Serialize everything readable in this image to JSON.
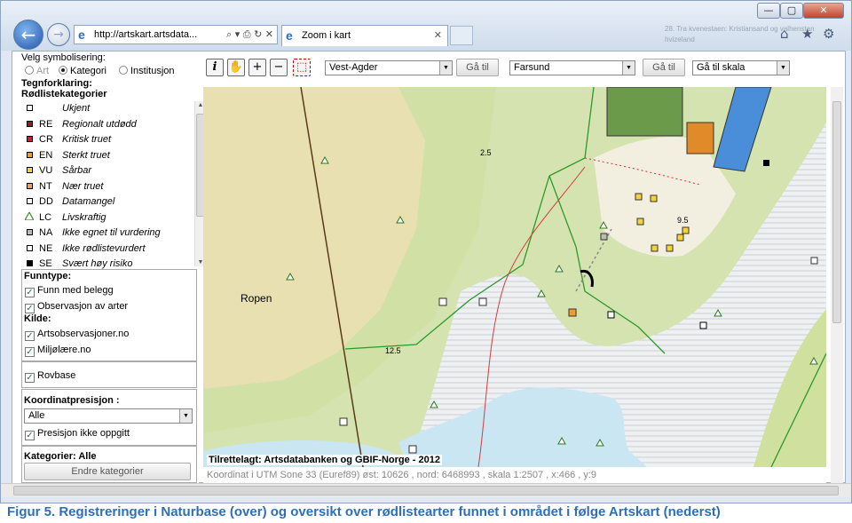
{
  "browser": {
    "url": "http://artskart.artsdata...",
    "url_controls": "⌕ ▾ ⎙ ↻ ✕",
    "tab_title": "Zoom i kart",
    "tab_close": "✕",
    "min_label": "—",
    "max_label": "▢",
    "close_label": "✕",
    "home_icon": "⌂",
    "star_icon": "★",
    "gear_icon": "⚙",
    "back_icon": "←",
    "forward_icon": "→",
    "background_text": "28. Tra kvenestaen: Kristiansand og valhenstan hvizeland"
  },
  "sidebar": {
    "symbolisering_label": "Velg symbolisering:",
    "radio_options": [
      {
        "label": "Art",
        "selected": false
      },
      {
        "label": "Kategori",
        "selected": true
      },
      {
        "label": "Institusjon",
        "selected": false
      }
    ],
    "tegnforklaring": "Tegnforklaring:",
    "rodliste_heading": "Rødlistekategorier",
    "legend": [
      {
        "symbol": "square-white",
        "code": "",
        "label": "Ukjent",
        "color": "#ffffff"
      },
      {
        "symbol": "square",
        "code": "RE",
        "label": "Regionalt utdødd",
        "color": "#9b1b1b"
      },
      {
        "symbol": "square",
        "code": "CR",
        "label": "Kritisk truet",
        "color": "#c8232c"
      },
      {
        "symbol": "square",
        "code": "EN",
        "label": "Sterkt truet",
        "color": "#f29a2e"
      },
      {
        "symbol": "square",
        "code": "VU",
        "label": "Sårbar",
        "color": "#f5d23a"
      },
      {
        "symbol": "square",
        "code": "NT",
        "label": "Nær truet",
        "color": "#f0a050"
      },
      {
        "symbol": "square-white",
        "code": "DD",
        "label": "Datamangel",
        "color": "#ffffff"
      },
      {
        "symbol": "triangle",
        "code": "LC",
        "label": "Livskraftig",
        "color": "#3a8a2a"
      },
      {
        "symbol": "square-grey",
        "code": "NA",
        "label": "Ikke egnet til vurdering",
        "color": "#bbbbbb"
      },
      {
        "symbol": "square-white",
        "code": "NE",
        "label": "Ikke rødlistevurdert",
        "color": "#ffffff"
      },
      {
        "symbol": "square-black",
        "code": "SE",
        "label": "Svært høy risiko",
        "color": "#000000"
      }
    ],
    "funntype_heading": "Funntype:",
    "funntype": [
      {
        "label": "Funn med belegg",
        "checked": true
      },
      {
        "label": "Observasjon av arter",
        "checked": true
      }
    ],
    "kilde_heading": "Kilde:",
    "kilde": [
      {
        "label": "Artsobservasjoner.no",
        "checked": true
      },
      {
        "label": "Miljølære.no",
        "checked": true
      }
    ],
    "rovbase": {
      "label": "Rovbase",
      "checked": true
    },
    "koordinat_heading": "Koordinatpresisjon :",
    "koordinat_value": "Alle",
    "presisjon": {
      "label": "Presisjon ikke oppgitt",
      "checked": true
    },
    "kategorier_label": "Kategorier: Alle",
    "endre_button": "Endre kategorier"
  },
  "toolbar": {
    "info_icon": "i",
    "pan_icon": "✋",
    "zoom_in_icon": "+",
    "zoom_out_icon": "−",
    "select_icon": "⬚",
    "fylke_value": "Vest-Agder",
    "ga_til_1": "Gå til",
    "kommune_value": "Farsund",
    "ga_til_2": "Gå til",
    "skala_value": "Gå til skala"
  },
  "map": {
    "place_label": "Ropen",
    "contour_labels": [
      "2.5",
      "9.5",
      "12.5"
    ],
    "attribution": "Tilrettelagt: Artsdatabanken og GBIF-Norge - 2012",
    "status": "Koordinat i UTM Sone 33 (Euref89) øst: 10626 , nord: 6468993 , skala 1:2507 , x:466 , y:9"
  },
  "caption": "Figur 5. Registreringer i Naturbase (over) og oversikt over rødlistearter funnet i området i følge Artskart (nederst)"
}
